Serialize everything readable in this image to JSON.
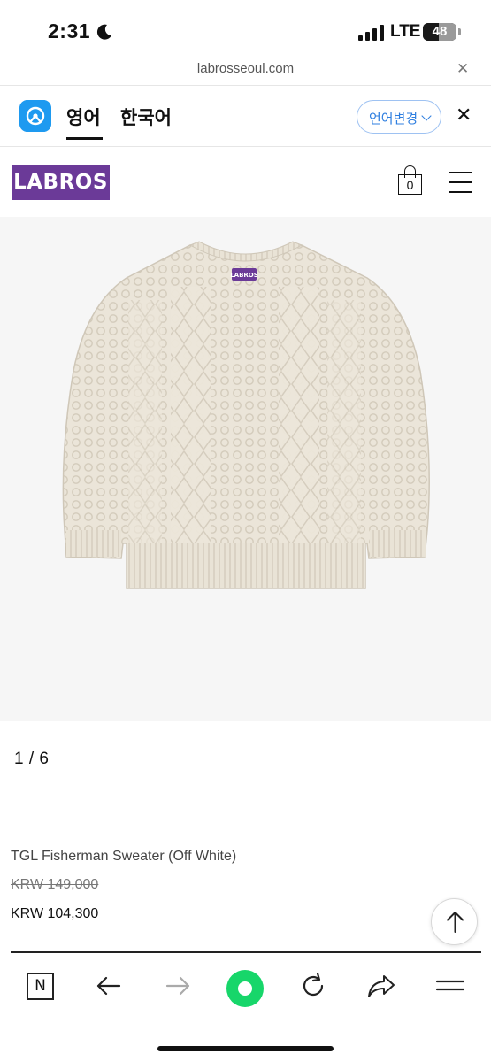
{
  "status_bar": {
    "time": "2:31",
    "network": "LTE",
    "battery": "48",
    "battery_level": 0.48
  },
  "browser": {
    "url": "labrosseoul.com",
    "close_icon": "close-icon"
  },
  "translate_bar": {
    "tabs": [
      "영어",
      "한국어"
    ],
    "active_tab": "영어",
    "change_language_label": "언어변경"
  },
  "header": {
    "logo": "LABROS",
    "cart_count": "0"
  },
  "product": {
    "pager": "1 / 6",
    "name": "TGL Fisherman Sweater (Off White)",
    "original_price": "KRW 149,000",
    "sale_price": "KRW 104,300",
    "sweater_label": "LABROS"
  },
  "toolbar": {
    "items": [
      "naver-icon",
      "back-arrow-icon",
      "forward-arrow-icon",
      "green-action-button",
      "reload-icon",
      "share-icon",
      "menu-icon"
    ]
  },
  "colors": {
    "brand_purple": "#6b3a98",
    "translate_blue": "#1e9af0",
    "link_blue": "#2f7fe0",
    "naver_green": "#17d66a",
    "sweater": "#ebe5d9"
  }
}
